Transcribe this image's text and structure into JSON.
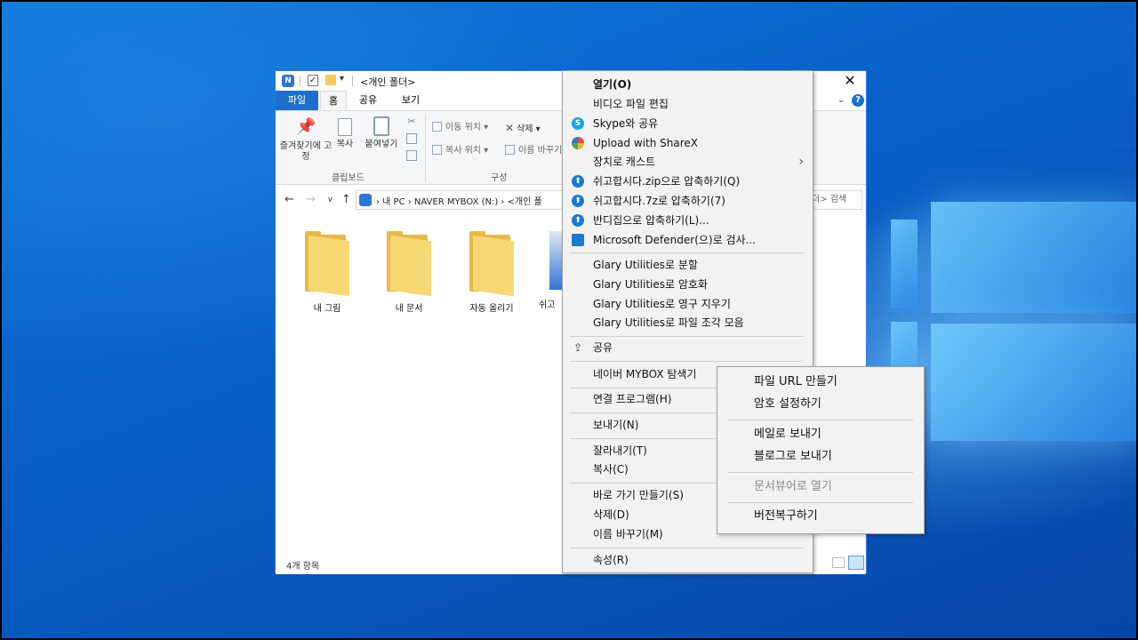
{
  "window": {
    "title": "<개인 폴더>",
    "close_glyph": "✕",
    "dropdown_glyph": "▾"
  },
  "ribbon": {
    "tabs": {
      "file": "파일",
      "home": "홈",
      "share": "공유",
      "view": "보기"
    },
    "pin_label": "즐겨찾기에 고정",
    "copy_label": "복사",
    "paste_label": "붙여넣기",
    "move_to": "이동 위치",
    "copy_to": "복사 위치",
    "delete": "삭제",
    "rename": "이름 바꾸기",
    "group_clipboard": "클립보드",
    "group_organize": "구성",
    "help_glyph": "?"
  },
  "address": {
    "breadcrumb": "› 내 PC › NAVER MYBOX (N:) › <개인 폴",
    "search_placeholder": "더> 검색"
  },
  "files": [
    {
      "name": "내 그림"
    },
    {
      "name": "내 문서"
    },
    {
      "name": "자동 올리기"
    },
    {
      "name": "쉬고"
    }
  ],
  "status": {
    "item_count": "4개 항목"
  },
  "context_menu": {
    "open": "열기(O)",
    "edit_video": "비디오 파일 편집",
    "skype_share": "Skype와 공유",
    "sharex_upload": "Upload with ShareX",
    "cast_to_device": "장치로 캐스트",
    "easy_zip": "쉬고합시다.zip으로 압축하기(Q)",
    "easy_7z": "쉬고합시다.7z로 압축하기(7)",
    "bandizip": "반디집으로 압축하기(L)...",
    "defender_scan": "Microsoft Defender(으)로 검사...",
    "glary_split": "Glary Utilities로 분할",
    "glary_encrypt": "Glary Utilities로 암호화",
    "glary_wipe": "Glary Utilities로 영구 지우기",
    "glary_defrag": "Glary Utilities로 파일 조각 모음",
    "share": "공유",
    "mybox_explorer": "네이버 MYBOX 탐색기",
    "open_with": "연결 프로그램(H)",
    "send_to": "보내기(N)",
    "cut": "잘라내기(T)",
    "copy": "복사(C)",
    "create_shortcut": "바로 가기 만들기(S)",
    "delete": "삭제(D)",
    "rename": "이름 바꾸기(M)",
    "properties": "속성(R)"
  },
  "submenu": {
    "make_url": "파일 URL 만들기",
    "set_password": "암호 설정하기",
    "send_mail": "메일로 보내기",
    "send_blog": "블로그로 보내기",
    "open_viewer": "문서뷰어로 열기",
    "version_restore": "버전복구하기"
  }
}
